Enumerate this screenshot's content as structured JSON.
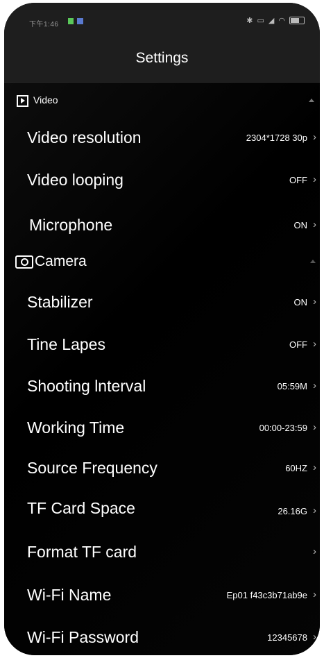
{
  "status_bar": {
    "time": "下午1:46",
    "colors": {
      "indicator_green": "#5ac85a",
      "indicator_blue": "#5a7ad0"
    }
  },
  "header": {
    "title": "Settings"
  },
  "sections": {
    "video": {
      "label": "Video",
      "icon": "video-icon",
      "rows": [
        {
          "label": "Video resolution",
          "value": "2304*1728 30p"
        },
        {
          "label": "Video looping",
          "value": "OFF"
        },
        {
          "label": "Microphone",
          "value": "ON"
        }
      ]
    },
    "camera": {
      "label": "Camera",
      "icon": "camera-icon",
      "rows": [
        {
          "label": "Stabilizer",
          "value": "ON"
        },
        {
          "label": "Tine Lapes",
          "value": "OFF"
        },
        {
          "label": "Shooting lnterval",
          "value": "05:59M"
        },
        {
          "label": "Working Time",
          "value": "00:00-23:59"
        },
        {
          "label": "Source Frequency",
          "value": "60HZ"
        },
        {
          "label": "TF Card Space",
          "value": "26.16G"
        },
        {
          "label": "Format TF card",
          "value": ""
        },
        {
          "label": "Wi-Fi Name",
          "value": "Ep01 f43c3b71ab9e"
        },
        {
          "label": "Wi-Fi Password",
          "value": "12345678"
        }
      ]
    }
  },
  "chevron_glyph": "›",
  "colors": {
    "background": "#000000",
    "bar": "#1e1e1e",
    "text": "#ffffff",
    "chevron": "#bbbbbb"
  }
}
